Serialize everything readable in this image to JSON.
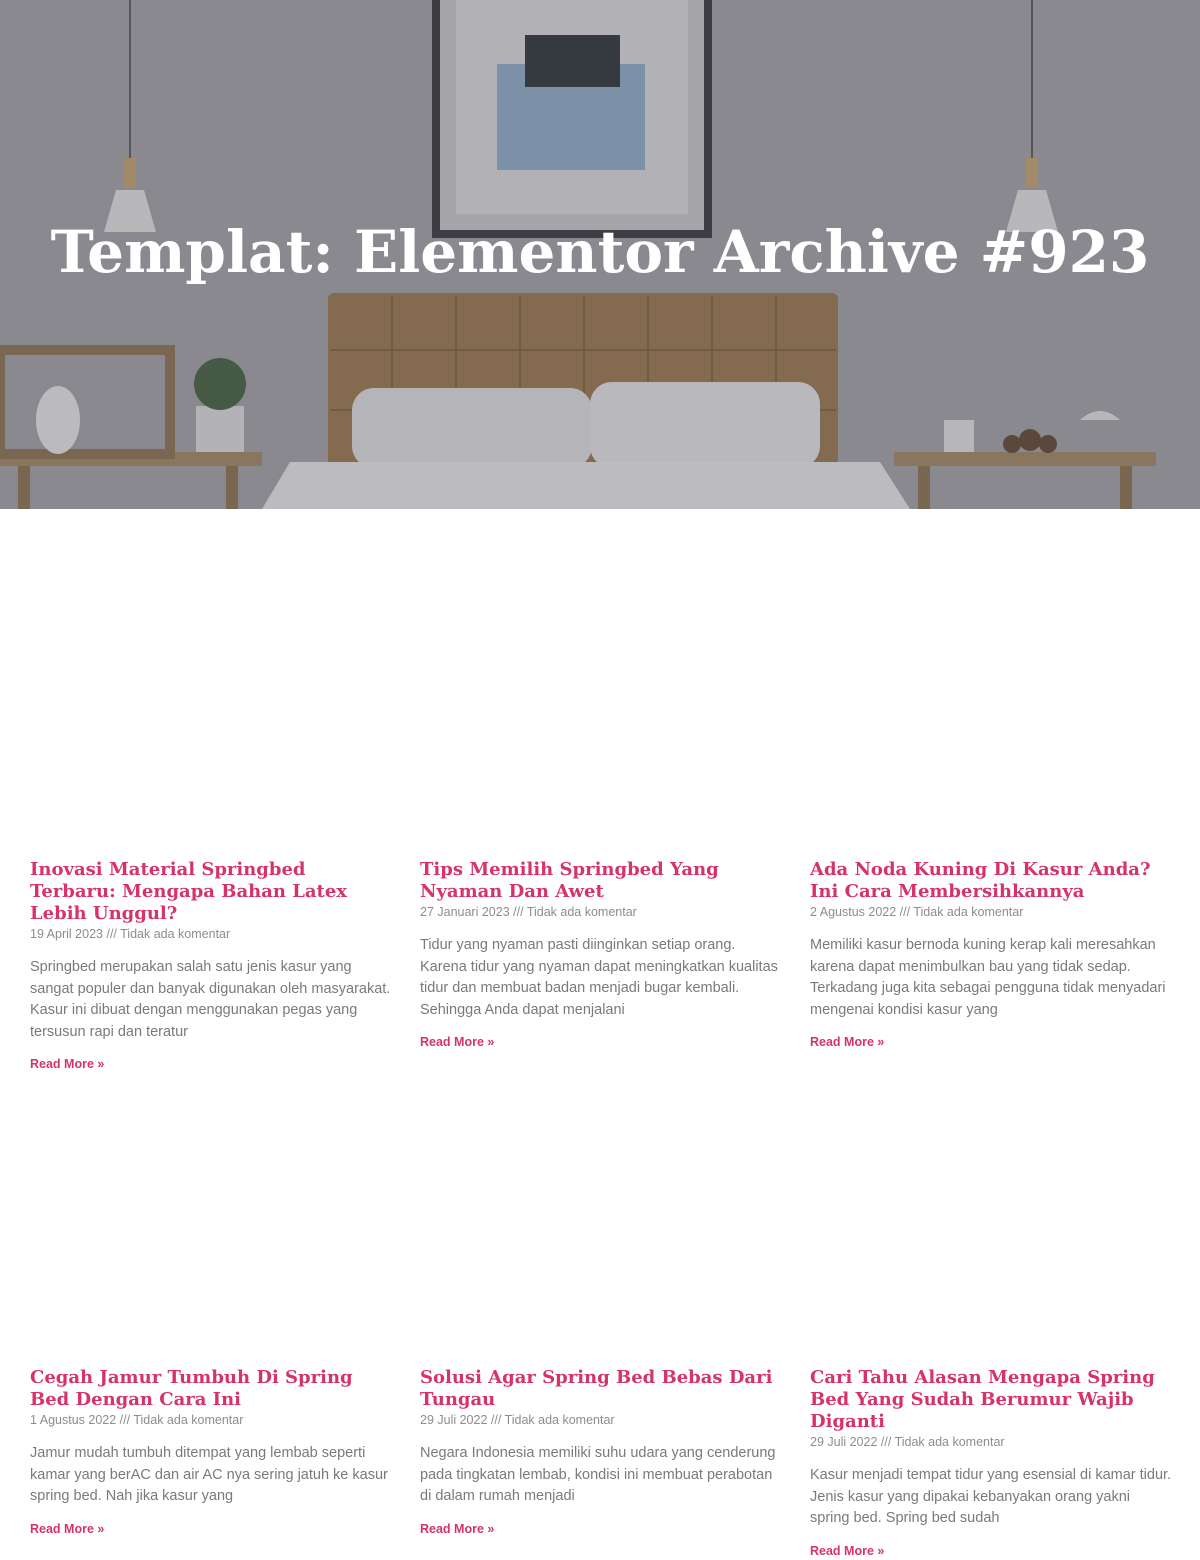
{
  "hero": {
    "title": "Templat: Elementor Archive #923"
  },
  "posts": [
    {
      "title": "Inovasi Material Springbed Terbaru: Mengapa Bahan Latex Lebih Unggul?",
      "date": "19 April 2023",
      "separator": "///",
      "comments": "Tidak ada komentar",
      "excerpt": "Springbed merupakan salah satu jenis kasur yang sangat populer dan banyak digunakan oleh masyarakat. Kasur ini dibuat dengan menggunakan pegas yang tersusun rapi dan teratur",
      "read_more": "Read More »"
    },
    {
      "title": "Tips Memilih Springbed Yang Nyaman Dan Awet",
      "date": "27 Januari 2023",
      "separator": "///",
      "comments": "Tidak ada komentar",
      "excerpt": "Tidur yang nyaman pasti diinginkan setiap orang. Karena tidur yang nyaman dapat meningkatkan kualitas tidur dan membuat badan menjadi bugar kembali. Sehingga Anda dapat menjalani",
      "read_more": "Read More »"
    },
    {
      "title": "Ada Noda Kuning Di Kasur Anda? Ini Cara Membersihkannya",
      "date": "2 Agustus 2022",
      "separator": "///",
      "comments": "Tidak ada komentar",
      "excerpt": "Memiliki kasur bernoda kuning kerap kali meresahkan karena dapat menimbulkan bau yang tidak sedap. Terkadang juga kita sebagai pengguna tidak menyadari mengenai kondisi kasur yang",
      "read_more": "Read More »"
    },
    {
      "title": "Cegah Jamur Tumbuh Di Spring Bed Dengan Cara Ini",
      "date": "1 Agustus 2022",
      "separator": "///",
      "comments": "Tidak ada komentar",
      "excerpt": "Jamur mudah tumbuh ditempat yang lembab seperti kamar yang berAC dan air AC nya sering jatuh ke kasur spring bed. Nah jika kasur yang",
      "read_more": "Read More »"
    },
    {
      "title": "Solusi Agar Spring Bed Bebas Dari Tungau",
      "date": "29 Juli 2022",
      "separator": "///",
      "comments": "Tidak ada komentar",
      "excerpt": "Negara Indonesia memiliki suhu udara yang cenderung pada tingkatan lembab, kondisi ini membuat perabotan di dalam rumah menjadi",
      "read_more": "Read More »"
    },
    {
      "title": "Cari Tahu Alasan Mengapa Spring Bed Yang Sudah Berumur Wajib Diganti",
      "date": "29 Juli 2022",
      "separator": "///",
      "comments": "Tidak ada komentar",
      "excerpt": "Kasur menjadi tempat tidur yang esensial di kamar tidur. Jenis kasur yang dipakai kebanyakan orang yakni spring bed. Spring bed sudah",
      "read_more": "Read More »"
    }
  ],
  "colors": {
    "accent": "#d6336c",
    "meta": "#8d8d8d",
    "excerpt": "#7a7a7a",
    "hero_overlay": "#5a5a62"
  }
}
